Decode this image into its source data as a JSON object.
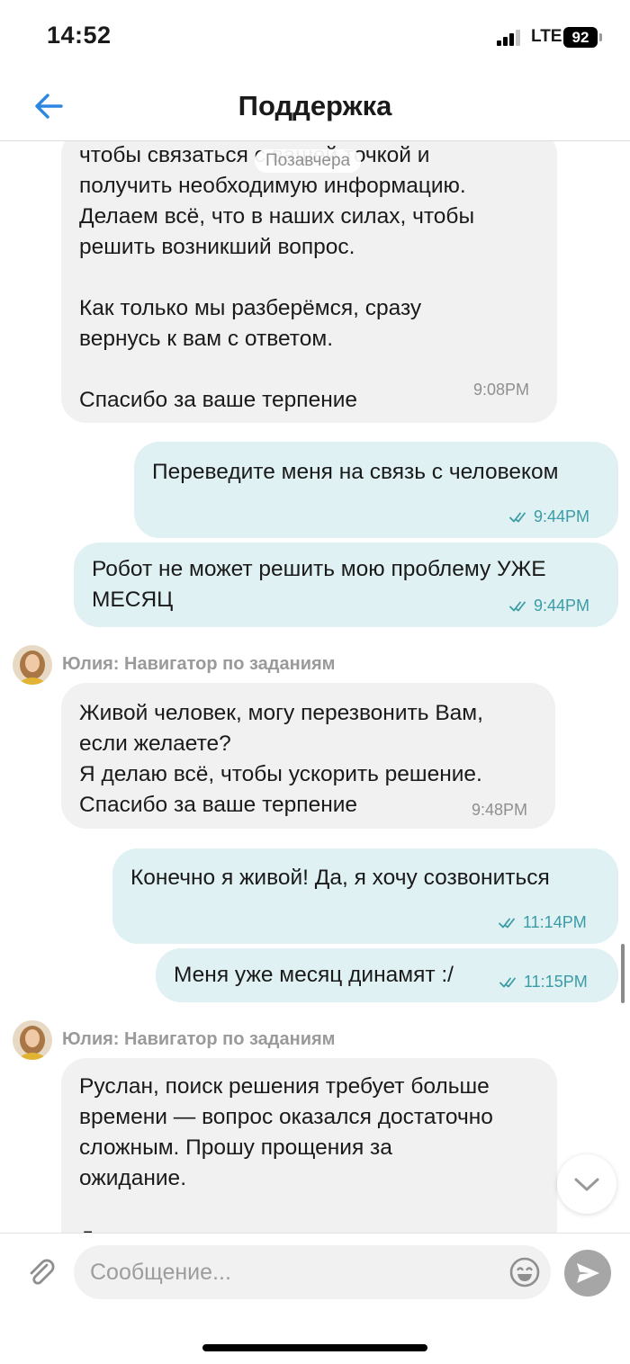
{
  "status_bar": {
    "time": "14:52",
    "network": "LTE",
    "battery": "92"
  },
  "header": {
    "title": "Поддержка"
  },
  "chat": {
    "date_chip": "Позавчера",
    "messages": [
      {
        "id": "m1",
        "direction": "in",
        "text": "чтобы связаться с вашей точкой и\nполучить необходимую информацию.\nДелаем всё, что в наших силах, чтобы\nрешить возникший вопрос.\n\nКак только мы разберёмся, сразу\nвернусь к вам с ответом.\n\nСпасибо за ваше терпение",
        "time": "9:08PM"
      },
      {
        "id": "m2",
        "direction": "out",
        "text": "Переведите меня на связь с человеком",
        "time": "9:44PM",
        "read": true
      },
      {
        "id": "m3",
        "direction": "out",
        "text": "Робот не может решить мою проблему УЖЕ\nМЕСЯЦ",
        "time": "9:44PM",
        "read": true
      },
      {
        "id": "m4",
        "direction": "in",
        "sender": "Юлия: Навигатор по заданиям",
        "text": "Живой человек, могу перезвонить Вам,\nесли желаете?\nЯ делаю всё, чтобы ускорить решение.\nСпасибо за ваше терпение",
        "time": "9:48PM"
      },
      {
        "id": "m5",
        "direction": "out",
        "text": "Конечно я живой! Да, я хочу созвониться",
        "time": "11:14PM",
        "read": true
      },
      {
        "id": "m6",
        "direction": "out",
        "text": "Меня уже месяц динамят :/",
        "time": "11:15PM",
        "read": true
      },
      {
        "id": "m7",
        "direction": "in",
        "sender": "Юлия: Навигатор по заданиям",
        "text": "Руслан, поиск решения требует больше\nвремени — вопрос оказался достаточно\nсложным. Прошу прощения за\nожидание.\n\nД",
        "time": ""
      }
    ]
  },
  "composer": {
    "placeholder": "Сообщение..."
  },
  "colors": {
    "accent": "#2d86e0",
    "outgoing_bubble": "#dff1f3",
    "incoming_bubble": "#f1f1f2",
    "read_check": "#3a9ca6"
  },
  "icons": {
    "back": "arrow-left-icon",
    "attach": "paperclip-icon",
    "emoji": "smile-icon",
    "send": "send-icon",
    "scroll_down": "chevron-down-icon"
  }
}
